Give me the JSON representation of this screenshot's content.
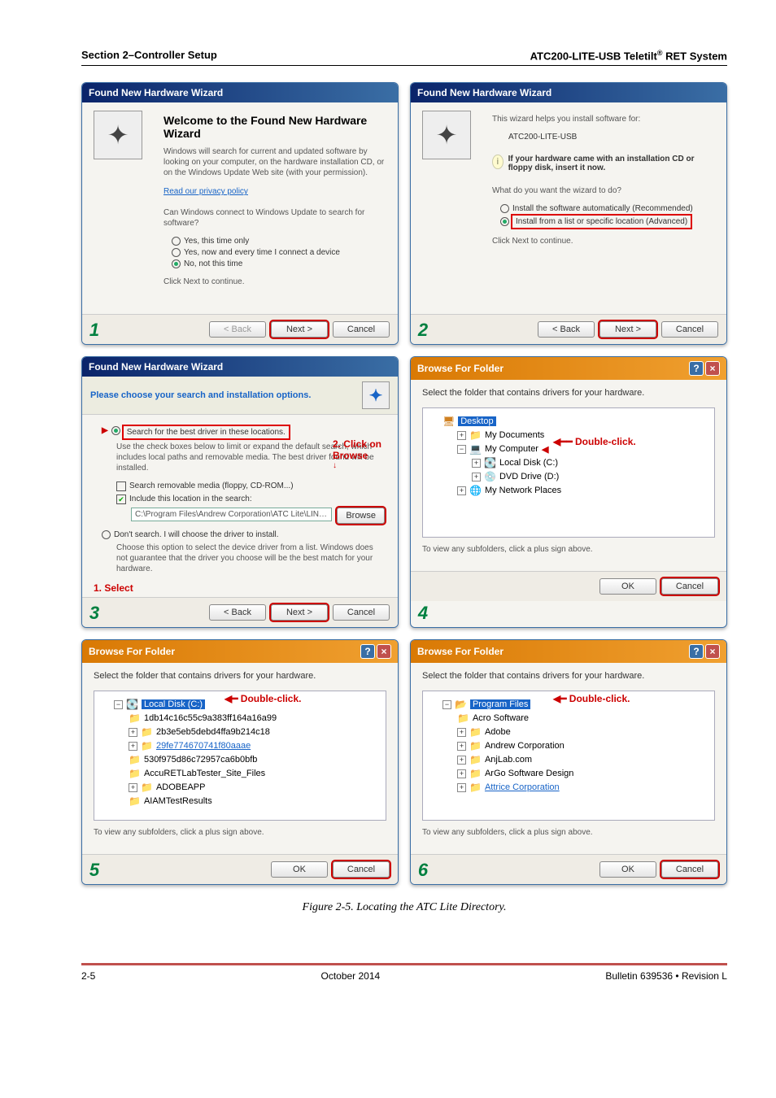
{
  "header": {
    "left": "Section 2–Controller Setup",
    "right_brand": "ATC200-LITE-USB Teletilt",
    "right_suffix": " RET System"
  },
  "dlg1": {
    "title": "Found New Hardware Wizard",
    "h1": "Welcome to the Found New Hardware Wizard",
    "p1": "Windows will search for current and updated software by looking on your computer, on the hardware installation CD, or on the Windows Update Web site (with your permission).",
    "link": "Read our privacy policy",
    "p2": "Can Windows connect to Windows Update to search for software?",
    "opt1": "Yes, this time only",
    "opt2": "Yes, now and every time I connect a device",
    "opt3": "No, not this time",
    "p3": "Click Next to continue.",
    "back": "< Back",
    "next": "Next >",
    "cancel": "Cancel",
    "step": "1"
  },
  "dlg2": {
    "title": "Found New Hardware Wizard",
    "p1": "This wizard helps you install software for:",
    "p1b": "ATC200-LITE-USB",
    "note": "If your hardware came with an installation CD or floppy disk, insert it now.",
    "p2": "What do you want the wizard to do?",
    "opt1": "Install the software automatically (Recommended)",
    "opt2": "Install from a list or specific location (Advanced)",
    "p3": "Click Next to continue.",
    "back": "< Back",
    "next": "Next >",
    "cancel": "Cancel",
    "step": "2"
  },
  "dlg3": {
    "title": "Found New Hardware Wizard",
    "sub": "Please choose your search and installation options.",
    "opt_main1": "Search for the best driver in these locations.",
    "desc1": "Use the check boxes below to limit or expand the default search, which includes local paths and removable media. The best driver found will be installed.",
    "cb1": "Search removable media (floppy, CD-ROM...)",
    "cb2": "Include this location in the search:",
    "path": "C:\\Program Files\\Andrew Corporation\\ATC Lite\\LIN…",
    "browse_btn": "Browse",
    "ann_click": "2. Click on",
    "ann_browse": "Browse",
    "opt_main2": "Don't search. I will choose the driver to install.",
    "desc2": "Choose this option to select the device driver from a list.  Windows does not guarantee that the driver you choose will be the best match for your hardware.",
    "ann_select": "1. Select",
    "back": "< Back",
    "next": "Next >",
    "cancel": "Cancel",
    "step": "3"
  },
  "dlg4": {
    "title": "Browse For Folder",
    "text": "Select the folder that contains drivers for your hardware.",
    "tree": {
      "root": "Desktop",
      "n1": "My Documents",
      "n2": "My Computer",
      "n2a": "Local Disk (C:)",
      "n2b": "DVD Drive (D:)",
      "n3": "My Network Places"
    },
    "ann": "Double-click.",
    "hint": "To view any subfolders, click a plus sign above.",
    "ok": "OK",
    "cancel": "Cancel",
    "step": "4"
  },
  "dlg5": {
    "title": "Browse For Folder",
    "text": "Select the folder that contains drivers for your hardware.",
    "tree": {
      "sel": "Local Disk (C:)",
      "items": [
        "1db14c16c55c9a383ff164a16a99",
        "2b3e5eb5debd4ffa9b214c18",
        "29fe774670741f80aaae",
        "530f975d86c72957ca6b0bfb",
        "AccuRETLabTester_Site_Files",
        "ADOBEAPP",
        "AIAMTestResults"
      ]
    },
    "ann": "Double-click.",
    "hint": "To view any subfolders, click a plus sign above.",
    "ok": "OK",
    "cancel": "Cancel",
    "step": "5"
  },
  "dlg6": {
    "title": "Browse For Folder",
    "text": "Select the folder that contains drivers for your hardware.",
    "tree": {
      "sel": "Program Files",
      "items": [
        "Acro Software",
        "Adobe",
        "Andrew Corporation",
        "AnjLab.com",
        "ArGo Software Design",
        "Attrice Corporation"
      ]
    },
    "ann": "Double-click.",
    "hint": "To view any subfolders, click a plus sign above.",
    "ok": "OK",
    "cancel": "Cancel",
    "step": "6"
  },
  "caption": "Figure 2-5. Locating the ATC Lite Directory.",
  "footer": {
    "left": "2-5",
    "center": "October 2014",
    "right": "Bulletin 639536  •  Revision L"
  }
}
